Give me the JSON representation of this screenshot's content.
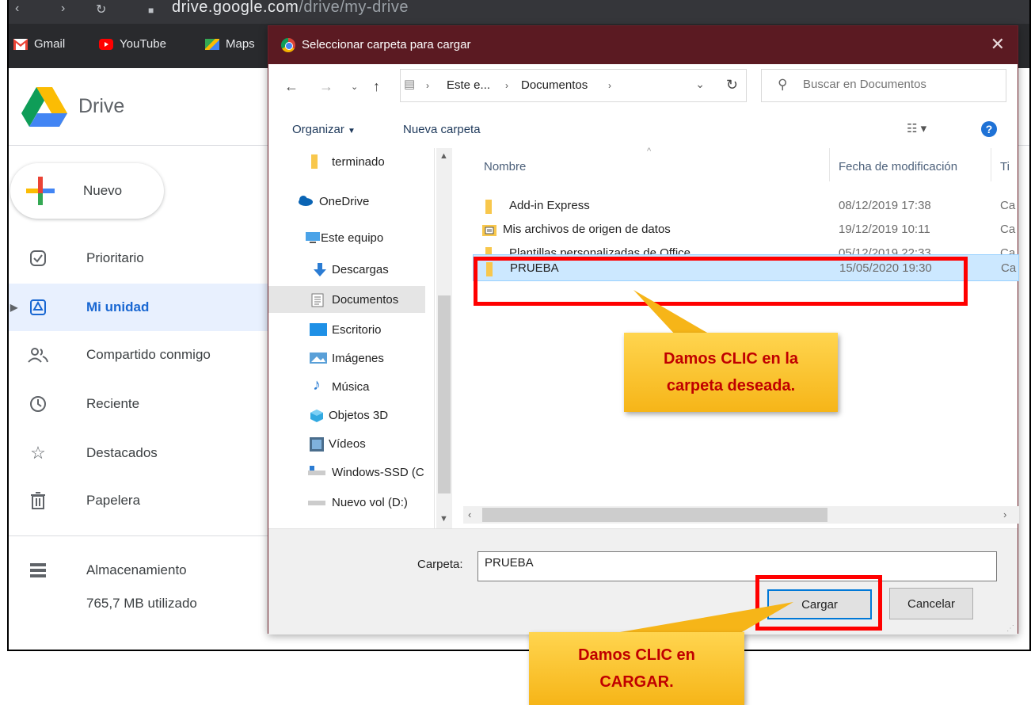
{
  "browser": {
    "url_host": "drive.google.com",
    "url_path": "/drive/my-drive",
    "bookmarks": [
      "Gmail",
      "YouTube",
      "Maps"
    ]
  },
  "drive": {
    "app_name": "Drive",
    "new_button": "Nuevo",
    "nav": [
      {
        "label": "Prioritario",
        "icon": "check-circle-icon"
      },
      {
        "label": "Mi unidad",
        "icon": "drive-icon",
        "active": true
      },
      {
        "label": "Compartido conmigo",
        "icon": "people-icon"
      },
      {
        "label": "Reciente",
        "icon": "clock-icon"
      },
      {
        "label": "Destacados",
        "icon": "star-icon"
      },
      {
        "label": "Papelera",
        "icon": "trash-icon"
      }
    ],
    "storage_label": "Almacenamiento",
    "storage_used": "765,7 MB utilizado"
  },
  "dialog": {
    "title": "Seleccionar carpeta para cargar",
    "breadcrumb": [
      "Este e...",
      "Documentos"
    ],
    "search_placeholder": "Buscar en Documentos",
    "toolbar": {
      "organize": "Organizar",
      "new_folder": "Nueva carpeta"
    },
    "tree": [
      {
        "label": "terminado",
        "icon": "folder-icon"
      },
      {
        "label": "OneDrive",
        "icon": "cloud-icon"
      },
      {
        "label": "Este equipo",
        "icon": "computer-icon"
      },
      {
        "label": "Descargas",
        "icon": "download-icon"
      },
      {
        "label": "Documentos",
        "icon": "document-icon",
        "selected": true
      },
      {
        "label": "Escritorio",
        "icon": "desktop-icon"
      },
      {
        "label": "Imágenes",
        "icon": "pictures-icon"
      },
      {
        "label": "Música",
        "icon": "music-icon"
      },
      {
        "label": "Objetos 3D",
        "icon": "cube-icon"
      },
      {
        "label": "Vídeos",
        "icon": "video-icon"
      },
      {
        "label": "Windows-SSD (C",
        "icon": "drive-c-icon"
      },
      {
        "label": "Nuevo vol (D:)",
        "icon": "drive-d-icon"
      }
    ],
    "columns": {
      "name": "Nombre",
      "date": "Fecha de modificación",
      "type": "Ti"
    },
    "files": [
      {
        "name": "Add-in Express",
        "date": "08/12/2019 17:38",
        "type": "Ca"
      },
      {
        "name": "Mis archivos de origen de datos",
        "date": "19/12/2019 10:11",
        "type": "Ca"
      },
      {
        "name": "Plantillas personalizadas de Office",
        "date": "05/12/2019 22:33",
        "type": "Ca"
      },
      {
        "name": "PRUEBA",
        "date": "15/05/2020 19:30",
        "type": "Ca",
        "selected": true
      }
    ],
    "folder_label": "Carpeta:",
    "folder_value": "PRUEBA",
    "upload_button": "Cargar",
    "cancel_button": "Cancelar"
  },
  "annotations": {
    "callout_folder": [
      "Damos CLIC en la",
      "carpeta deseada."
    ],
    "callout_upload": [
      "Damos CLIC en",
      "CARGAR."
    ]
  }
}
